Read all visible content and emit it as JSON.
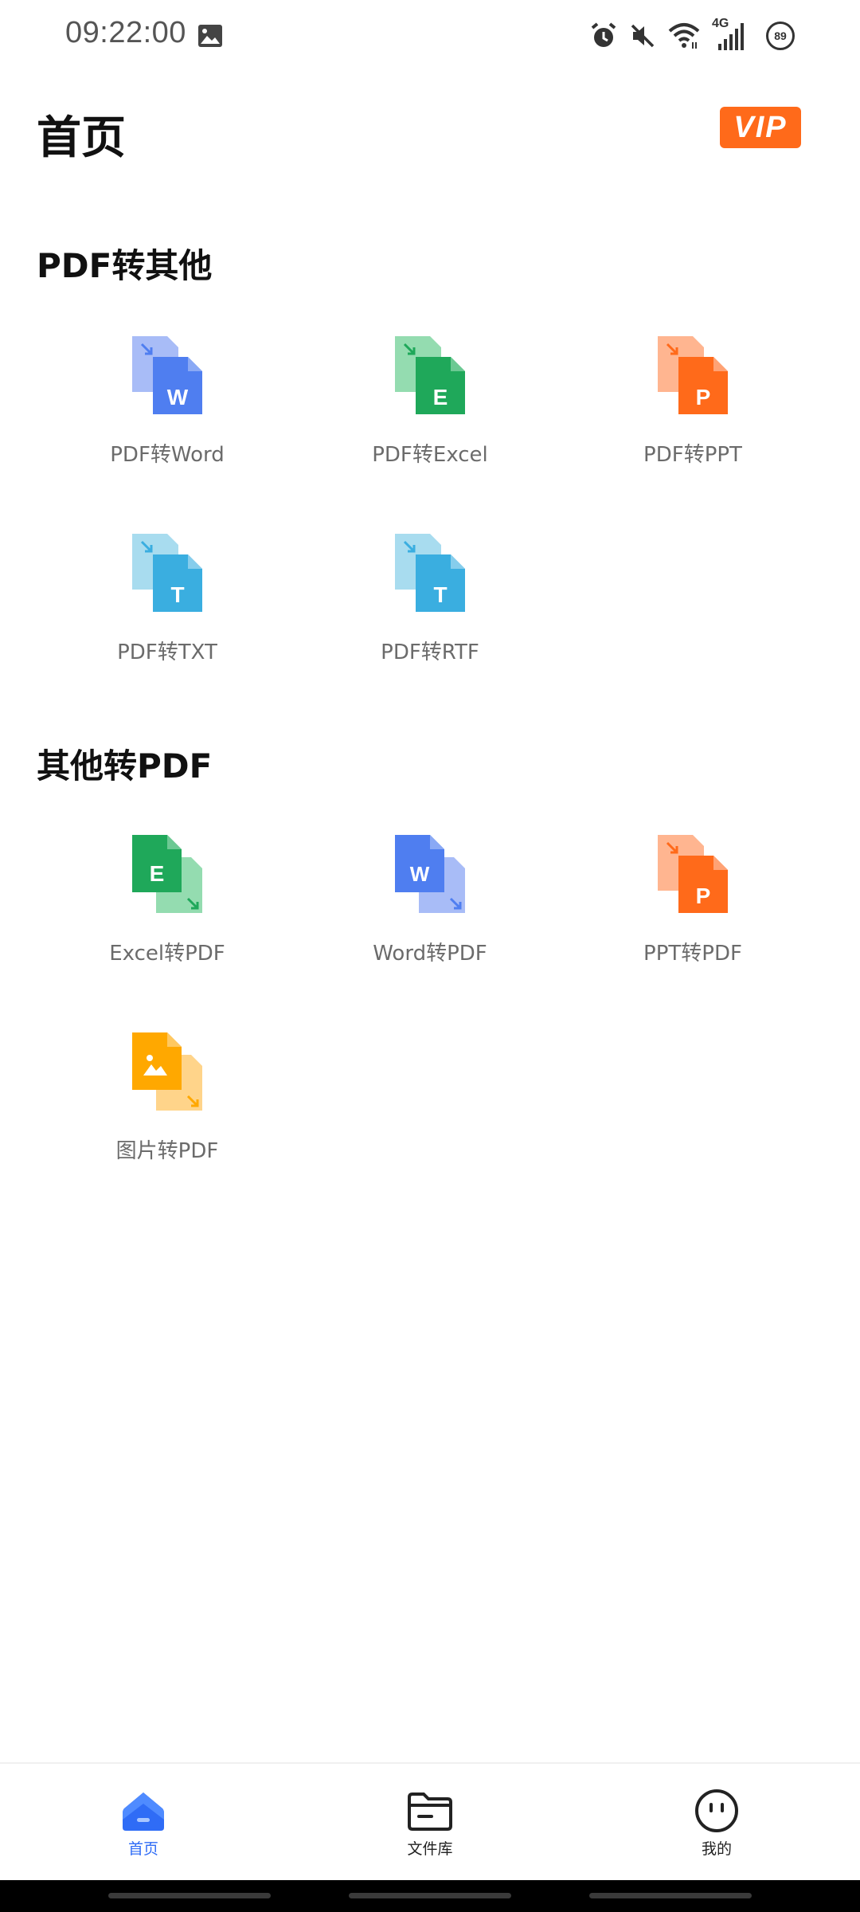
{
  "status_bar": {
    "time": "09:22:00",
    "network": "4G",
    "battery": "89",
    "icons": [
      "image-icon",
      "alarm-icon",
      "mute-icon",
      "wifi-icon",
      "signal-icon",
      "battery-icon"
    ]
  },
  "header": {
    "title": "首页",
    "vip_label": "VIP",
    "vip_color": "#ff6a1a"
  },
  "sections": [
    {
      "title": "PDF转其他",
      "items": [
        {
          "label": "PDF转Word",
          "icon": "pdf-to-word-icon",
          "color": "#4f7ef0"
        },
        {
          "label": "PDF转Excel",
          "icon": "pdf-to-excel-icon",
          "color": "#1fa85a"
        },
        {
          "label": "PDF转PPT",
          "icon": "pdf-to-ppt-icon",
          "color": "#ff6a1a"
        },
        {
          "label": "PDF转TXT",
          "icon": "pdf-to-txt-icon",
          "color": "#3aaee0"
        },
        {
          "label": "PDF转RTF",
          "icon": "pdf-to-rtf-icon",
          "color": "#3aaee0"
        }
      ]
    },
    {
      "title": "其他转PDF",
      "items": [
        {
          "label": "Excel转PDF",
          "icon": "excel-to-pdf-icon",
          "color": "#1fa85a"
        },
        {
          "label": "Word转PDF",
          "icon": "word-to-pdf-icon",
          "color": "#4f7ef0"
        },
        {
          "label": "PPT转PDF",
          "icon": "ppt-to-pdf-icon",
          "color": "#ff6a1a"
        },
        {
          "label": "图片转PDF",
          "icon": "image-to-pdf-icon",
          "color": "#ffa800"
        }
      ]
    }
  ],
  "bottom_nav": {
    "items": [
      {
        "label": "首页",
        "icon": "home-icon",
        "active": true
      },
      {
        "label": "文件库",
        "icon": "folder-icon",
        "active": false
      },
      {
        "label": "我的",
        "icon": "profile-face-icon",
        "active": false
      }
    ],
    "active_color": "#2f6cf6"
  }
}
